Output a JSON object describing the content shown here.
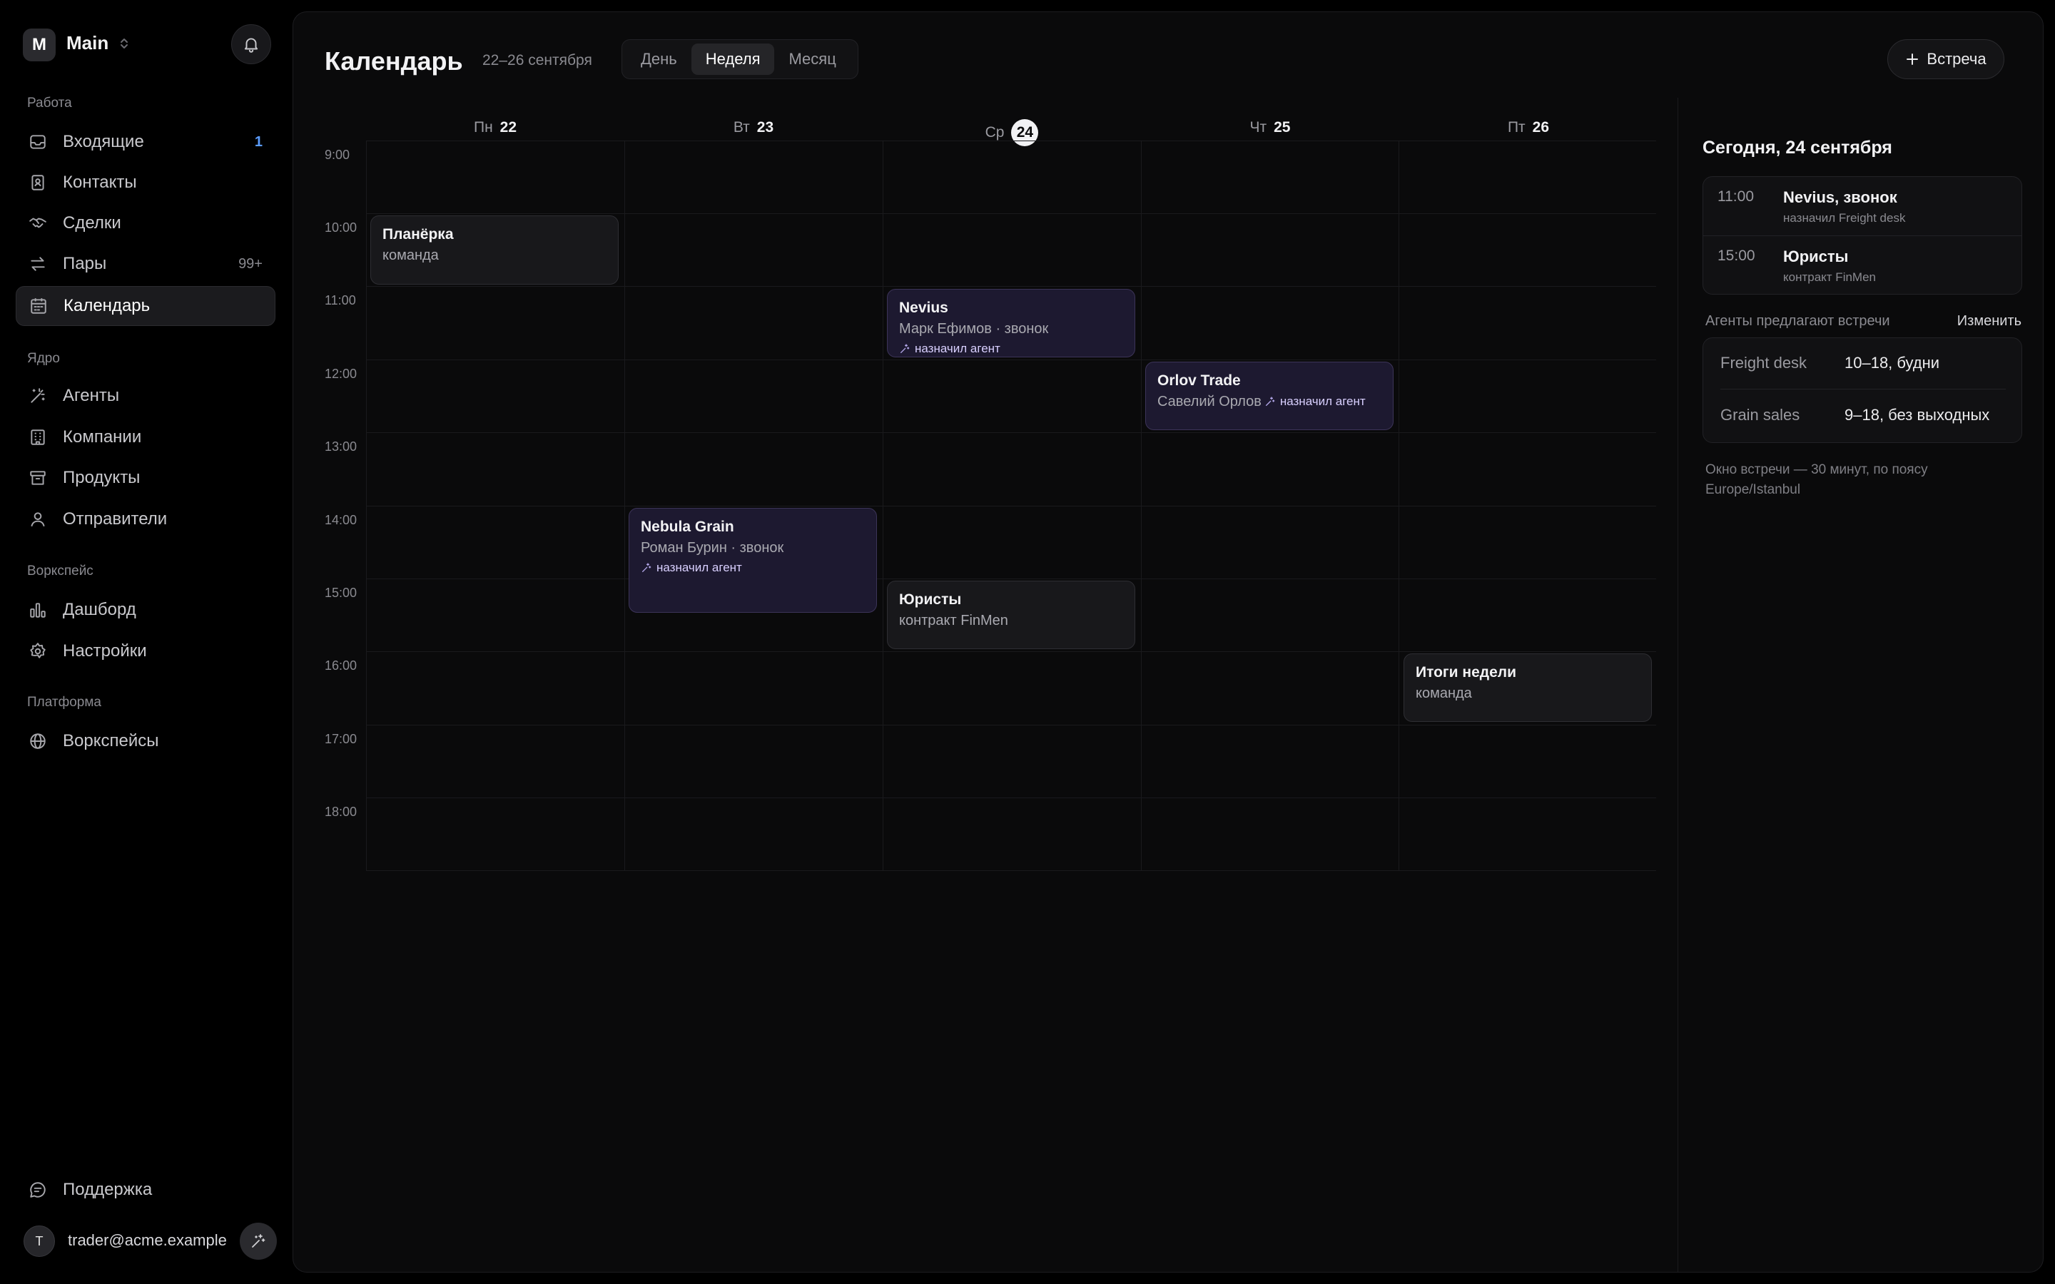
{
  "workspace": {
    "avatar_letter": "M",
    "name": "Main"
  },
  "sidebar": {
    "sections": [
      {
        "label": "Работа",
        "items": [
          {
            "label": "Входящие",
            "badge": "1",
            "icon": "inbox-icon"
          },
          {
            "label": "Контакты",
            "badge": "",
            "icon": "contacts-icon"
          },
          {
            "label": "Сделки",
            "badge": "",
            "icon": "handshake-icon"
          },
          {
            "label": "Пары",
            "badge": "99+",
            "icon": "arrows-swap-icon"
          },
          {
            "label": "Календарь",
            "badge": "",
            "icon": "calendar-icon",
            "active": true
          }
        ]
      },
      {
        "label": "Ядро",
        "items": [
          {
            "label": "Агенты",
            "icon": "agent-wand-icon"
          },
          {
            "label": "Компании",
            "icon": "building-icon"
          },
          {
            "label": "Продукты",
            "icon": "archive-box-icon"
          },
          {
            "label": "Отправители",
            "icon": "user-icon"
          }
        ]
      },
      {
        "label": "Воркспейс",
        "items": [
          {
            "label": "Дашборд",
            "icon": "bar-chart-icon"
          },
          {
            "label": "Настройки",
            "icon": "gear-icon"
          }
        ]
      },
      {
        "label": "Платформа",
        "items": [
          {
            "label": "Воркспейсы",
            "icon": "globe-icon"
          }
        ]
      }
    ],
    "support_label": "Поддержка",
    "user": {
      "avatar_letter": "T",
      "email": "trader@acme.example"
    }
  },
  "header": {
    "title": "Календарь",
    "date_range": "22–26 сентября",
    "views": [
      "День",
      "Неделя",
      "Месяц"
    ],
    "active_view": "Неделя",
    "add_button": "Встреча"
  },
  "calendar": {
    "days": [
      {
        "weekday": "Пн",
        "date": "22"
      },
      {
        "weekday": "Вт",
        "date": "23"
      },
      {
        "weekday": "Ср",
        "date": "24",
        "today": true
      },
      {
        "weekday": "Чт",
        "date": "25"
      },
      {
        "weekday": "Пт",
        "date": "26"
      }
    ],
    "hours": [
      "9:00",
      "10:00",
      "11:00",
      "12:00",
      "13:00",
      "14:00",
      "15:00",
      "16:00",
      "17:00",
      "18:00"
    ],
    "agent_tag": "назначил агент",
    "events": [
      {
        "day": 0,
        "start": 10,
        "end": 11,
        "title": "Планёрка",
        "subtitle": "команда",
        "agent": false
      },
      {
        "day": 1,
        "start": 14,
        "end": 15.5,
        "title": "Nebula Grain",
        "subtitle": "Роман Бурин · звонок",
        "agent": true
      },
      {
        "day": 2,
        "start": 11,
        "end": 12,
        "title": "Nevius",
        "subtitle": "Марк Ефимов · звонок",
        "agent": true
      },
      {
        "day": 2,
        "start": 15,
        "end": 16,
        "title": "Юристы",
        "subtitle": "контракт FinMen",
        "agent": false
      },
      {
        "day": 3,
        "start": 12,
        "end": 13,
        "title": "Orlov Trade",
        "subtitle": "Савелий Орлов",
        "agent": true,
        "inline_agent": true
      },
      {
        "day": 4,
        "start": 16,
        "end": 17,
        "title": "Итоги недели",
        "subtitle": "команда",
        "agent": false
      }
    ]
  },
  "right_panel": {
    "title": "Сегодня, 24 сентября",
    "today": [
      {
        "time": "11:00",
        "title": "Nevius, звонок",
        "sub": "назначил Freight desk"
      },
      {
        "time": "15:00",
        "title": "Юристы",
        "sub": "контракт FinMen"
      }
    ],
    "agents_label": "Агенты предлагают встречи",
    "agents_edit": "Изменить",
    "agents": [
      {
        "name": "Freight desk",
        "hours": "10–18, будни"
      },
      {
        "name": "Grain sales",
        "hours": "9–18, без выходных"
      }
    ],
    "note": "Окно встречи — 30 минут, по поясу Europe/Istanbul"
  }
}
